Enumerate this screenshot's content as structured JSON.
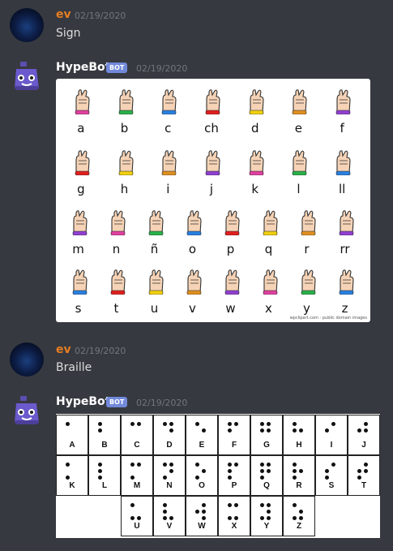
{
  "messages": {
    "m1": {
      "author": "ev",
      "timestamp": "02/19/2020",
      "text": "Sign"
    },
    "m2": {
      "author": "HypeBot",
      "badge": "BOT",
      "timestamp": "02/19/2020"
    },
    "m3": {
      "author": "ev",
      "timestamp": "02/19/2020",
      "text": "Braille"
    },
    "m4": {
      "author": "HypeBot",
      "badge": "BOT",
      "timestamp": "02/19/2020"
    }
  },
  "colors": {
    "author_ev": "#e67e22",
    "background": "#36393f",
    "bot_badge": "#7289da"
  },
  "icons": {
    "ev_avatar": "dark-blue-orb-avatar",
    "bot_avatar": "purple-robot-avatar"
  },
  "asl_chart": {
    "rows": [
      [
        "a",
        "b",
        "c",
        "ch",
        "d",
        "e",
        "f"
      ],
      [
        "g",
        "h",
        "i",
        "j",
        "k",
        "l",
        "ll"
      ],
      [
        "m",
        "n",
        "ñ",
        "o",
        "p",
        "q",
        "r",
        "rr"
      ],
      [
        "s",
        "t",
        "u",
        "v",
        "w",
        "x",
        "y",
        "z"
      ]
    ],
    "credit": "wpclipart.com - public domain images"
  },
  "braille_chart": {
    "rows": [
      [
        "A",
        "B",
        "C",
        "D",
        "E",
        "F",
        "G",
        "H",
        "I",
        "J"
      ],
      [
        "K",
        "L",
        "M",
        "N",
        "O",
        "P",
        "Q",
        "R",
        "S",
        "T"
      ],
      [
        "",
        "",
        "U",
        "V",
        "W",
        "X",
        "Y",
        "Z",
        "",
        ""
      ]
    ],
    "dots": {
      "A": [
        1
      ],
      "B": [
        1,
        2
      ],
      "C": [
        1,
        4
      ],
      "D": [
        1,
        4,
        5
      ],
      "E": [
        1,
        5
      ],
      "F": [
        1,
        2,
        4
      ],
      "G": [
        1,
        2,
        4,
        5
      ],
      "H": [
        1,
        2,
        5
      ],
      "I": [
        2,
        4
      ],
      "J": [
        2,
        4,
        5
      ],
      "K": [
        1,
        3
      ],
      "L": [
        1,
        2,
        3
      ],
      "M": [
        1,
        3,
        4
      ],
      "N": [
        1,
        3,
        4,
        5
      ],
      "O": [
        1,
        3,
        5
      ],
      "P": [
        1,
        2,
        3,
        4
      ],
      "Q": [
        1,
        2,
        3,
        4,
        5
      ],
      "R": [
        1,
        2,
        3,
        5
      ],
      "S": [
        2,
        3,
        4
      ],
      "T": [
        2,
        3,
        4,
        5
      ],
      "U": [
        1,
        3,
        6
      ],
      "V": [
        1,
        2,
        3,
        6
      ],
      "W": [
        2,
        4,
        5,
        6
      ],
      "X": [
        1,
        3,
        4,
        6
      ],
      "Y": [
        1,
        3,
        4,
        5,
        6
      ],
      "Z": [
        1,
        3,
        5,
        6
      ]
    }
  }
}
